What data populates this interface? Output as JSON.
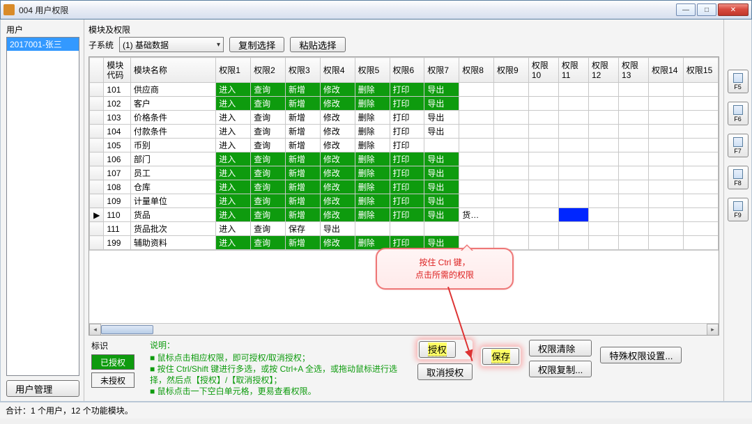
{
  "window": {
    "title": "004 用户权限"
  },
  "left": {
    "label": "用户",
    "selected_user": "2017001-张三",
    "user_mgmt": "用户管理"
  },
  "sub": {
    "modlabel": "模块及权限",
    "label": "子系统",
    "selected": "(1) 基础数据",
    "copy": "复制选择",
    "paste": "粘贴选择"
  },
  "headers": {
    "rowsel": "",
    "code": "模块\n代码",
    "name": "模块名称",
    "p": [
      "权限1",
      "权限2",
      "权限3",
      "权限4",
      "权限5",
      "权限6",
      "权限7",
      "权限8",
      "权限9",
      "权限\n10",
      "权限\n11",
      "权限\n12",
      "权限\n13",
      "权限14",
      "权限15"
    ]
  },
  "rows": [
    {
      "cur": "",
      "code": "101",
      "name": "供应商",
      "perms": [
        {
          "t": "进入",
          "on": 1
        },
        {
          "t": "查询",
          "on": 1
        },
        {
          "t": "新增",
          "on": 1
        },
        {
          "t": "修改",
          "on": 1
        },
        {
          "t": "删除",
          "on": 1
        },
        {
          "t": "打印",
          "on": 1
        },
        {
          "t": "导出",
          "on": 1
        },
        {
          "t": "",
          "on": 0
        },
        {
          "t": "",
          "on": 0
        },
        {
          "t": "",
          "on": 0
        },
        {
          "t": "",
          "on": 0
        },
        {
          "t": "",
          "on": 0
        },
        {
          "t": "",
          "on": 0
        },
        {
          "t": "",
          "on": 0
        },
        {
          "t": "",
          "on": 0
        }
      ]
    },
    {
      "cur": "",
      "code": "102",
      "name": "客户",
      "perms": [
        {
          "t": "进入",
          "on": 1
        },
        {
          "t": "查询",
          "on": 1
        },
        {
          "t": "新增",
          "on": 1
        },
        {
          "t": "修改",
          "on": 1
        },
        {
          "t": "删除",
          "on": 1
        },
        {
          "t": "打印",
          "on": 1
        },
        {
          "t": "导出",
          "on": 1
        },
        {
          "t": "",
          "on": 0
        },
        {
          "t": "",
          "on": 0
        },
        {
          "t": "",
          "on": 0
        },
        {
          "t": "",
          "on": 0
        },
        {
          "t": "",
          "on": 0
        },
        {
          "t": "",
          "on": 0
        },
        {
          "t": "",
          "on": 0
        },
        {
          "t": "",
          "on": 0
        }
      ]
    },
    {
      "cur": "",
      "code": "103",
      "name": "价格条件",
      "perms": [
        {
          "t": "进入",
          "on": 0
        },
        {
          "t": "查询",
          "on": 0
        },
        {
          "t": "新增",
          "on": 0
        },
        {
          "t": "修改",
          "on": 0
        },
        {
          "t": "删除",
          "on": 0
        },
        {
          "t": "打印",
          "on": 0
        },
        {
          "t": "导出",
          "on": 0
        },
        {
          "t": "",
          "on": 0
        },
        {
          "t": "",
          "on": 0
        },
        {
          "t": "",
          "on": 0
        },
        {
          "t": "",
          "on": 0
        },
        {
          "t": "",
          "on": 0
        },
        {
          "t": "",
          "on": 0
        },
        {
          "t": "",
          "on": 0
        },
        {
          "t": "",
          "on": 0
        }
      ]
    },
    {
      "cur": "",
      "code": "104",
      "name": "付款条件",
      "perms": [
        {
          "t": "进入",
          "on": 0
        },
        {
          "t": "查询",
          "on": 0
        },
        {
          "t": "新增",
          "on": 0
        },
        {
          "t": "修改",
          "on": 0
        },
        {
          "t": "删除",
          "on": 0
        },
        {
          "t": "打印",
          "on": 0
        },
        {
          "t": "导出",
          "on": 0
        },
        {
          "t": "",
          "on": 0
        },
        {
          "t": "",
          "on": 0
        },
        {
          "t": "",
          "on": 0
        },
        {
          "t": "",
          "on": 0
        },
        {
          "t": "",
          "on": 0
        },
        {
          "t": "",
          "on": 0
        },
        {
          "t": "",
          "on": 0
        },
        {
          "t": "",
          "on": 0
        }
      ]
    },
    {
      "cur": "",
      "code": "105",
      "name": "币别",
      "perms": [
        {
          "t": "进入",
          "on": 0
        },
        {
          "t": "查询",
          "on": 0
        },
        {
          "t": "新增",
          "on": 0
        },
        {
          "t": "修改",
          "on": 0
        },
        {
          "t": "删除",
          "on": 0
        },
        {
          "t": "打印",
          "on": 0
        },
        {
          "t": "",
          "on": 0
        },
        {
          "t": "",
          "on": 0
        },
        {
          "t": "",
          "on": 0
        },
        {
          "t": "",
          "on": 0
        },
        {
          "t": "",
          "on": 0
        },
        {
          "t": "",
          "on": 0
        },
        {
          "t": "",
          "on": 0
        },
        {
          "t": "",
          "on": 0
        },
        {
          "t": "",
          "on": 0
        }
      ]
    },
    {
      "cur": "",
      "code": "106",
      "name": "部门",
      "perms": [
        {
          "t": "进入",
          "on": 1
        },
        {
          "t": "查询",
          "on": 1
        },
        {
          "t": "新增",
          "on": 1
        },
        {
          "t": "修改",
          "on": 1
        },
        {
          "t": "删除",
          "on": 1
        },
        {
          "t": "打印",
          "on": 1
        },
        {
          "t": "导出",
          "on": 1
        },
        {
          "t": "",
          "on": 0
        },
        {
          "t": "",
          "on": 0
        },
        {
          "t": "",
          "on": 0
        },
        {
          "t": "",
          "on": 0
        },
        {
          "t": "",
          "on": 0
        },
        {
          "t": "",
          "on": 0
        },
        {
          "t": "",
          "on": 0
        },
        {
          "t": "",
          "on": 0
        }
      ]
    },
    {
      "cur": "",
      "code": "107",
      "name": "员工",
      "perms": [
        {
          "t": "进入",
          "on": 1
        },
        {
          "t": "查询",
          "on": 1
        },
        {
          "t": "新增",
          "on": 1
        },
        {
          "t": "修改",
          "on": 1
        },
        {
          "t": "删除",
          "on": 1
        },
        {
          "t": "打印",
          "on": 1
        },
        {
          "t": "导出",
          "on": 1
        },
        {
          "t": "",
          "on": 0
        },
        {
          "t": "",
          "on": 0
        },
        {
          "t": "",
          "on": 0
        },
        {
          "t": "",
          "on": 0
        },
        {
          "t": "",
          "on": 0
        },
        {
          "t": "",
          "on": 0
        },
        {
          "t": "",
          "on": 0
        },
        {
          "t": "",
          "on": 0
        }
      ]
    },
    {
      "cur": "",
      "code": "108",
      "name": "仓库",
      "perms": [
        {
          "t": "进入",
          "on": 1
        },
        {
          "t": "查询",
          "on": 1
        },
        {
          "t": "新增",
          "on": 1
        },
        {
          "t": "修改",
          "on": 1
        },
        {
          "t": "删除",
          "on": 1
        },
        {
          "t": "打印",
          "on": 1
        },
        {
          "t": "导出",
          "on": 1
        },
        {
          "t": "",
          "on": 0
        },
        {
          "t": "",
          "on": 0
        },
        {
          "t": "",
          "on": 0
        },
        {
          "t": "",
          "on": 0
        },
        {
          "t": "",
          "on": 0
        },
        {
          "t": "",
          "on": 0
        },
        {
          "t": "",
          "on": 0
        },
        {
          "t": "",
          "on": 0
        }
      ]
    },
    {
      "cur": "",
      "code": "109",
      "name": "计量单位",
      "perms": [
        {
          "t": "进入",
          "on": 1
        },
        {
          "t": "查询",
          "on": 1
        },
        {
          "t": "新增",
          "on": 1
        },
        {
          "t": "修改",
          "on": 1
        },
        {
          "t": "删除",
          "on": 1
        },
        {
          "t": "打印",
          "on": 1
        },
        {
          "t": "导出",
          "on": 1
        },
        {
          "t": "",
          "on": 0
        },
        {
          "t": "",
          "on": 0
        },
        {
          "t": "",
          "on": 0
        },
        {
          "t": "",
          "on": 0
        },
        {
          "t": "",
          "on": 0
        },
        {
          "t": "",
          "on": 0
        },
        {
          "t": "",
          "on": 0
        },
        {
          "t": "",
          "on": 0
        }
      ]
    },
    {
      "cur": "▶",
      "code": "110",
      "name": "货品",
      "perms": [
        {
          "t": "进入",
          "on": 1
        },
        {
          "t": "查询",
          "on": 1
        },
        {
          "t": "新增",
          "on": 1
        },
        {
          "t": "修改",
          "on": 1
        },
        {
          "t": "删除",
          "on": 1
        },
        {
          "t": "打印",
          "on": 1
        },
        {
          "t": "导出",
          "on": 1
        },
        {
          "t": "货…",
          "on": 0
        },
        {
          "t": "",
          "on": 0
        },
        {
          "t": "",
          "on": 0
        },
        {
          "t": "",
          "on": 0,
          "blue": 1
        },
        {
          "t": "",
          "on": 0
        },
        {
          "t": "",
          "on": 0
        },
        {
          "t": "",
          "on": 0
        },
        {
          "t": "",
          "on": 0
        }
      ]
    },
    {
      "cur": "",
      "code": "111",
      "name": "货品批次",
      "perms": [
        {
          "t": "进入",
          "on": 0
        },
        {
          "t": "查询",
          "on": 0
        },
        {
          "t": "保存",
          "on": 0
        },
        {
          "t": "导出",
          "on": 0
        },
        {
          "t": "",
          "on": 0
        },
        {
          "t": "",
          "on": 0
        },
        {
          "t": "",
          "on": 0
        },
        {
          "t": "",
          "on": 0
        },
        {
          "t": "",
          "on": 0
        },
        {
          "t": "",
          "on": 0
        },
        {
          "t": "",
          "on": 0
        },
        {
          "t": "",
          "on": 0
        },
        {
          "t": "",
          "on": 0
        },
        {
          "t": "",
          "on": 0
        },
        {
          "t": "",
          "on": 0
        }
      ]
    },
    {
      "cur": "",
      "code": "199",
      "name": "辅助资料",
      "perms": [
        {
          "t": "进入",
          "on": 1
        },
        {
          "t": "查询",
          "on": 1
        },
        {
          "t": "新增",
          "on": 1
        },
        {
          "t": "修改",
          "on": 1
        },
        {
          "t": "删除",
          "on": 1
        },
        {
          "t": "打印",
          "on": 1
        },
        {
          "t": "导出",
          "on": 1
        },
        {
          "t": "",
          "on": 0
        },
        {
          "t": "",
          "on": 0
        },
        {
          "t": "",
          "on": 0
        },
        {
          "t": "",
          "on": 0
        },
        {
          "t": "",
          "on": 0
        },
        {
          "t": "",
          "on": 0
        },
        {
          "t": "",
          "on": 0
        },
        {
          "t": "",
          "on": 0
        }
      ]
    }
  ],
  "side": {
    "f5": "F5",
    "f6": "F6",
    "f7": "F7",
    "f8": "F8",
    "f9": "F9"
  },
  "marks": {
    "label": "标识",
    "on": "已授权",
    "off": "未授权"
  },
  "help": {
    "title": "说明：",
    "l1": "■ 鼠标点击相应权限，即可授权/取消授权；",
    "l2": "■ 按住 Ctrl/Shift 键进行多选，或按 Ctrl+A 全选，或拖动鼠标进行选择，然后点【授权】/【取消授权】；",
    "l3": "■ 鼠标点击一下空白单元格，更易查看权限。"
  },
  "actions": {
    "grant": "授权",
    "revoke": "取消授权",
    "save": "保存",
    "clear": "权限清除",
    "copy": "权限复制...",
    "special": "特殊权限设置..."
  },
  "callout": {
    "l1": "按住 Ctrl 键，",
    "l2": "点击所需的权限"
  },
  "status": "合计：1 个用户，12 个功能模块。"
}
